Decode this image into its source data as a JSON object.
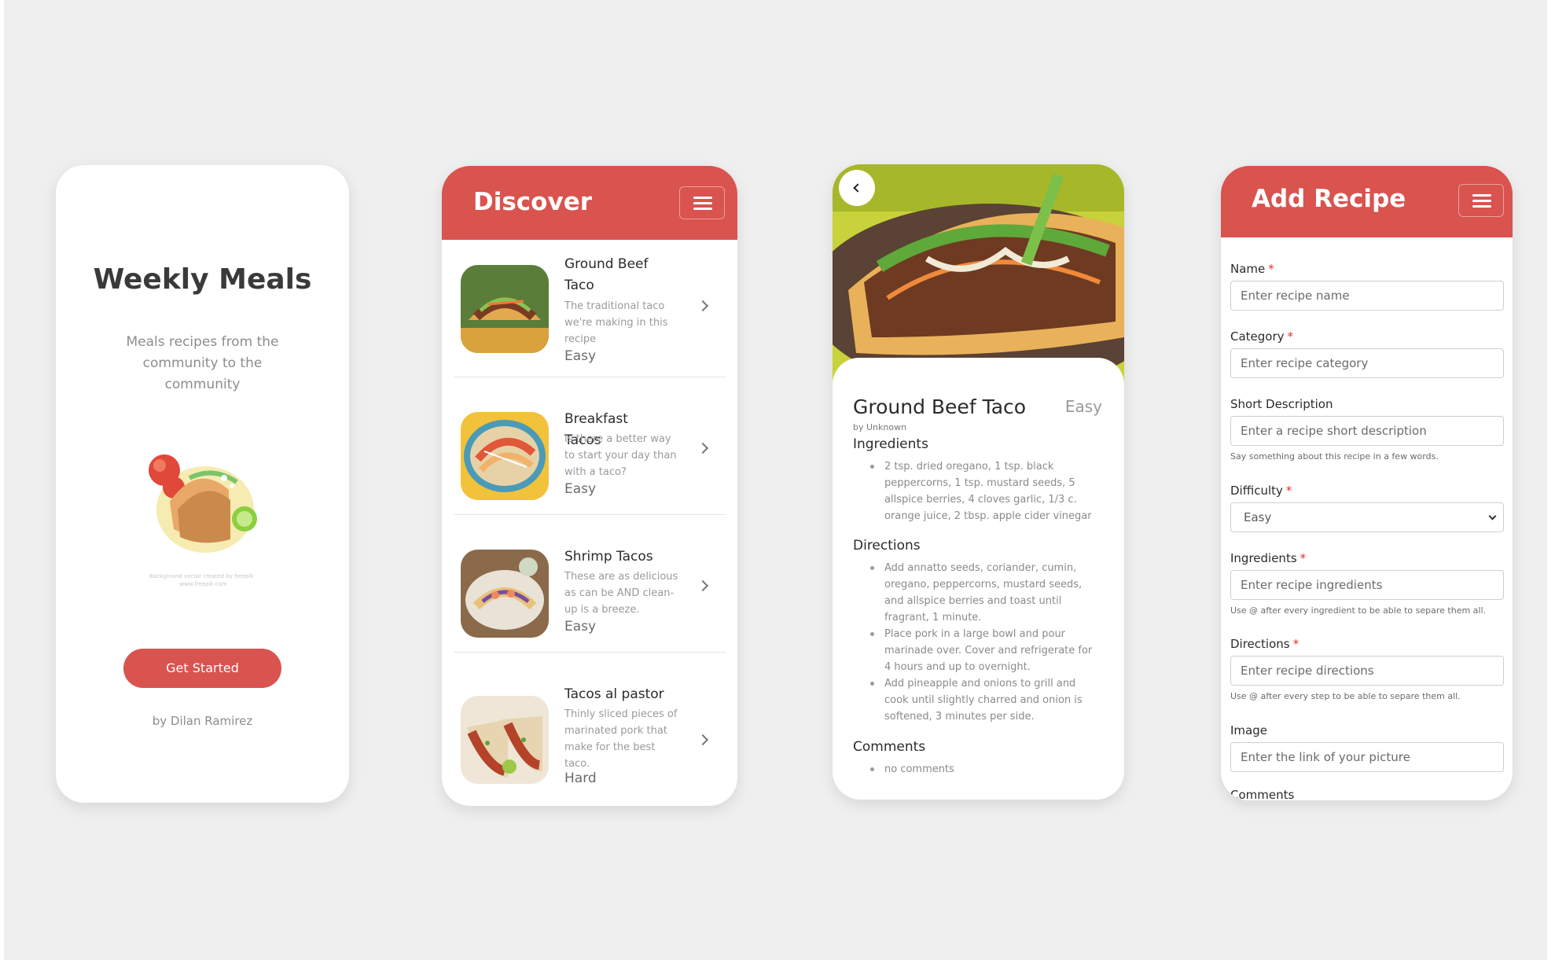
{
  "welcome": {
    "title": "Weekly Meals",
    "subtitle": "Meals recipes from the community to the community",
    "credit": "Background vector created by freepik - www.freepik.com",
    "button": "Get Started",
    "author": "by Dilan Ramirez"
  },
  "discover": {
    "title": "Discover",
    "recipes": [
      {
        "name": "Ground Beef Taco",
        "desc": "The traditional taco we're making in this recipe",
        "difficulty": "Easy"
      },
      {
        "name": "Breakfast Tacos",
        "desc": "Is there a better way to start your day than with a taco?",
        "difficulty": "Easy"
      },
      {
        "name": "Shrimp Tacos",
        "desc": "These are as delicious as can be AND clean-up is a breeze.",
        "difficulty": "Easy"
      },
      {
        "name": "Tacos al pastor",
        "desc": "Thinly sliced pieces of marinated pork that make for the best taco.",
        "difficulty": "Hard"
      }
    ]
  },
  "detail": {
    "title": "Ground Beef Taco",
    "difficulty": "Easy",
    "author": "by Unknown",
    "ingredients_heading": "Ingredients",
    "ingredients": [
      "2 tsp. dried oregano, 1 tsp. black peppercorns, 1 tsp. mustard seeds, 5 allspice berries, 4 cloves garlic, 1/3 c. orange juice, 2 tbsp. apple cider vinegar"
    ],
    "directions_heading": "Directions",
    "directions": [
      "Add annatto seeds, coriander, cumin, oregano, peppercorns, mustard seeds, and allspice berries and toast until fragrant, 1 minute.",
      "Place pork in a large bowl and pour marinade over. Cover and refrigerate for 4 hours and up to overnight.",
      "Add pineapple and onions to grill and cook until slightly charred and onion is softened, 3 minutes per side."
    ],
    "comments_heading": "Comments",
    "comments": [
      "no comments"
    ]
  },
  "add_recipe": {
    "title": "Add Recipe",
    "fields": {
      "name": {
        "label": "Name",
        "placeholder": "Enter recipe name"
      },
      "category": {
        "label": "Category",
        "placeholder": "Enter recipe category"
      },
      "short_description": {
        "label": "Short Description",
        "placeholder": "Enter a recipe short description",
        "help": "Say something about this recipe in a few words."
      },
      "difficulty": {
        "label": "Difficulty",
        "value": "Easy"
      },
      "ingredients": {
        "label": "Ingredients",
        "placeholder": "Enter recipe ingredients",
        "help": "Use @ after every ingredient to be able to separe them all."
      },
      "directions": {
        "label": "Directions",
        "placeholder": "Enter recipe directions",
        "help": "Use @ after every step to be able to separe them all."
      },
      "image": {
        "label": "Image",
        "placeholder": "Enter the link of your picture"
      },
      "comments": {
        "label": "Comments"
      }
    },
    "required_mark": "*"
  },
  "colors": {
    "accent": "#d9534f",
    "background": "#efefef",
    "required": "#e0312b"
  }
}
